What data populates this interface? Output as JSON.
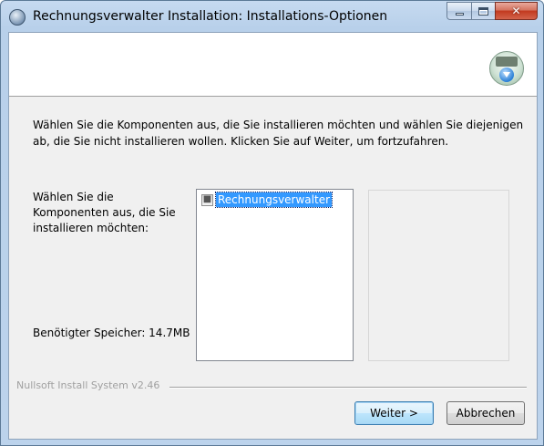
{
  "window": {
    "title": "Rechnungsverwalter Installation: Installations-Optionen",
    "app_icon": "installer-globe-icon",
    "caption_buttons": {
      "minimize_icon": "minimize-icon",
      "maximize_icon": "maximize-icon",
      "close_icon": "close-icon",
      "close_glyph": "✕"
    }
  },
  "header": {
    "logo_icon": "nsis-installer-logo-icon"
  },
  "main": {
    "intro_text": "Wählen Sie die Komponenten aus, die Sie installieren möchten und wählen Sie diejenigen ab, die Sie nicht installieren wollen. Klicken Sie auf Weiter, um fortzufahren.",
    "components_label": "Wählen Sie die Komponenten aus, die Sie installieren möchten:",
    "space_required": "Benötigter Speicher: 14.7MB",
    "components": [
      {
        "label": "Rechnungsverwalter",
        "checked": true,
        "disabled": true,
        "selected": true
      }
    ]
  },
  "footer": {
    "branding": "Nullsoft Install System v2.46",
    "next_label": "Weiter >",
    "cancel_label": "Abbrechen"
  },
  "colors": {
    "selection": "#3399ff",
    "title_bar": "#bcd3ec",
    "close_button": "#c2391f"
  }
}
